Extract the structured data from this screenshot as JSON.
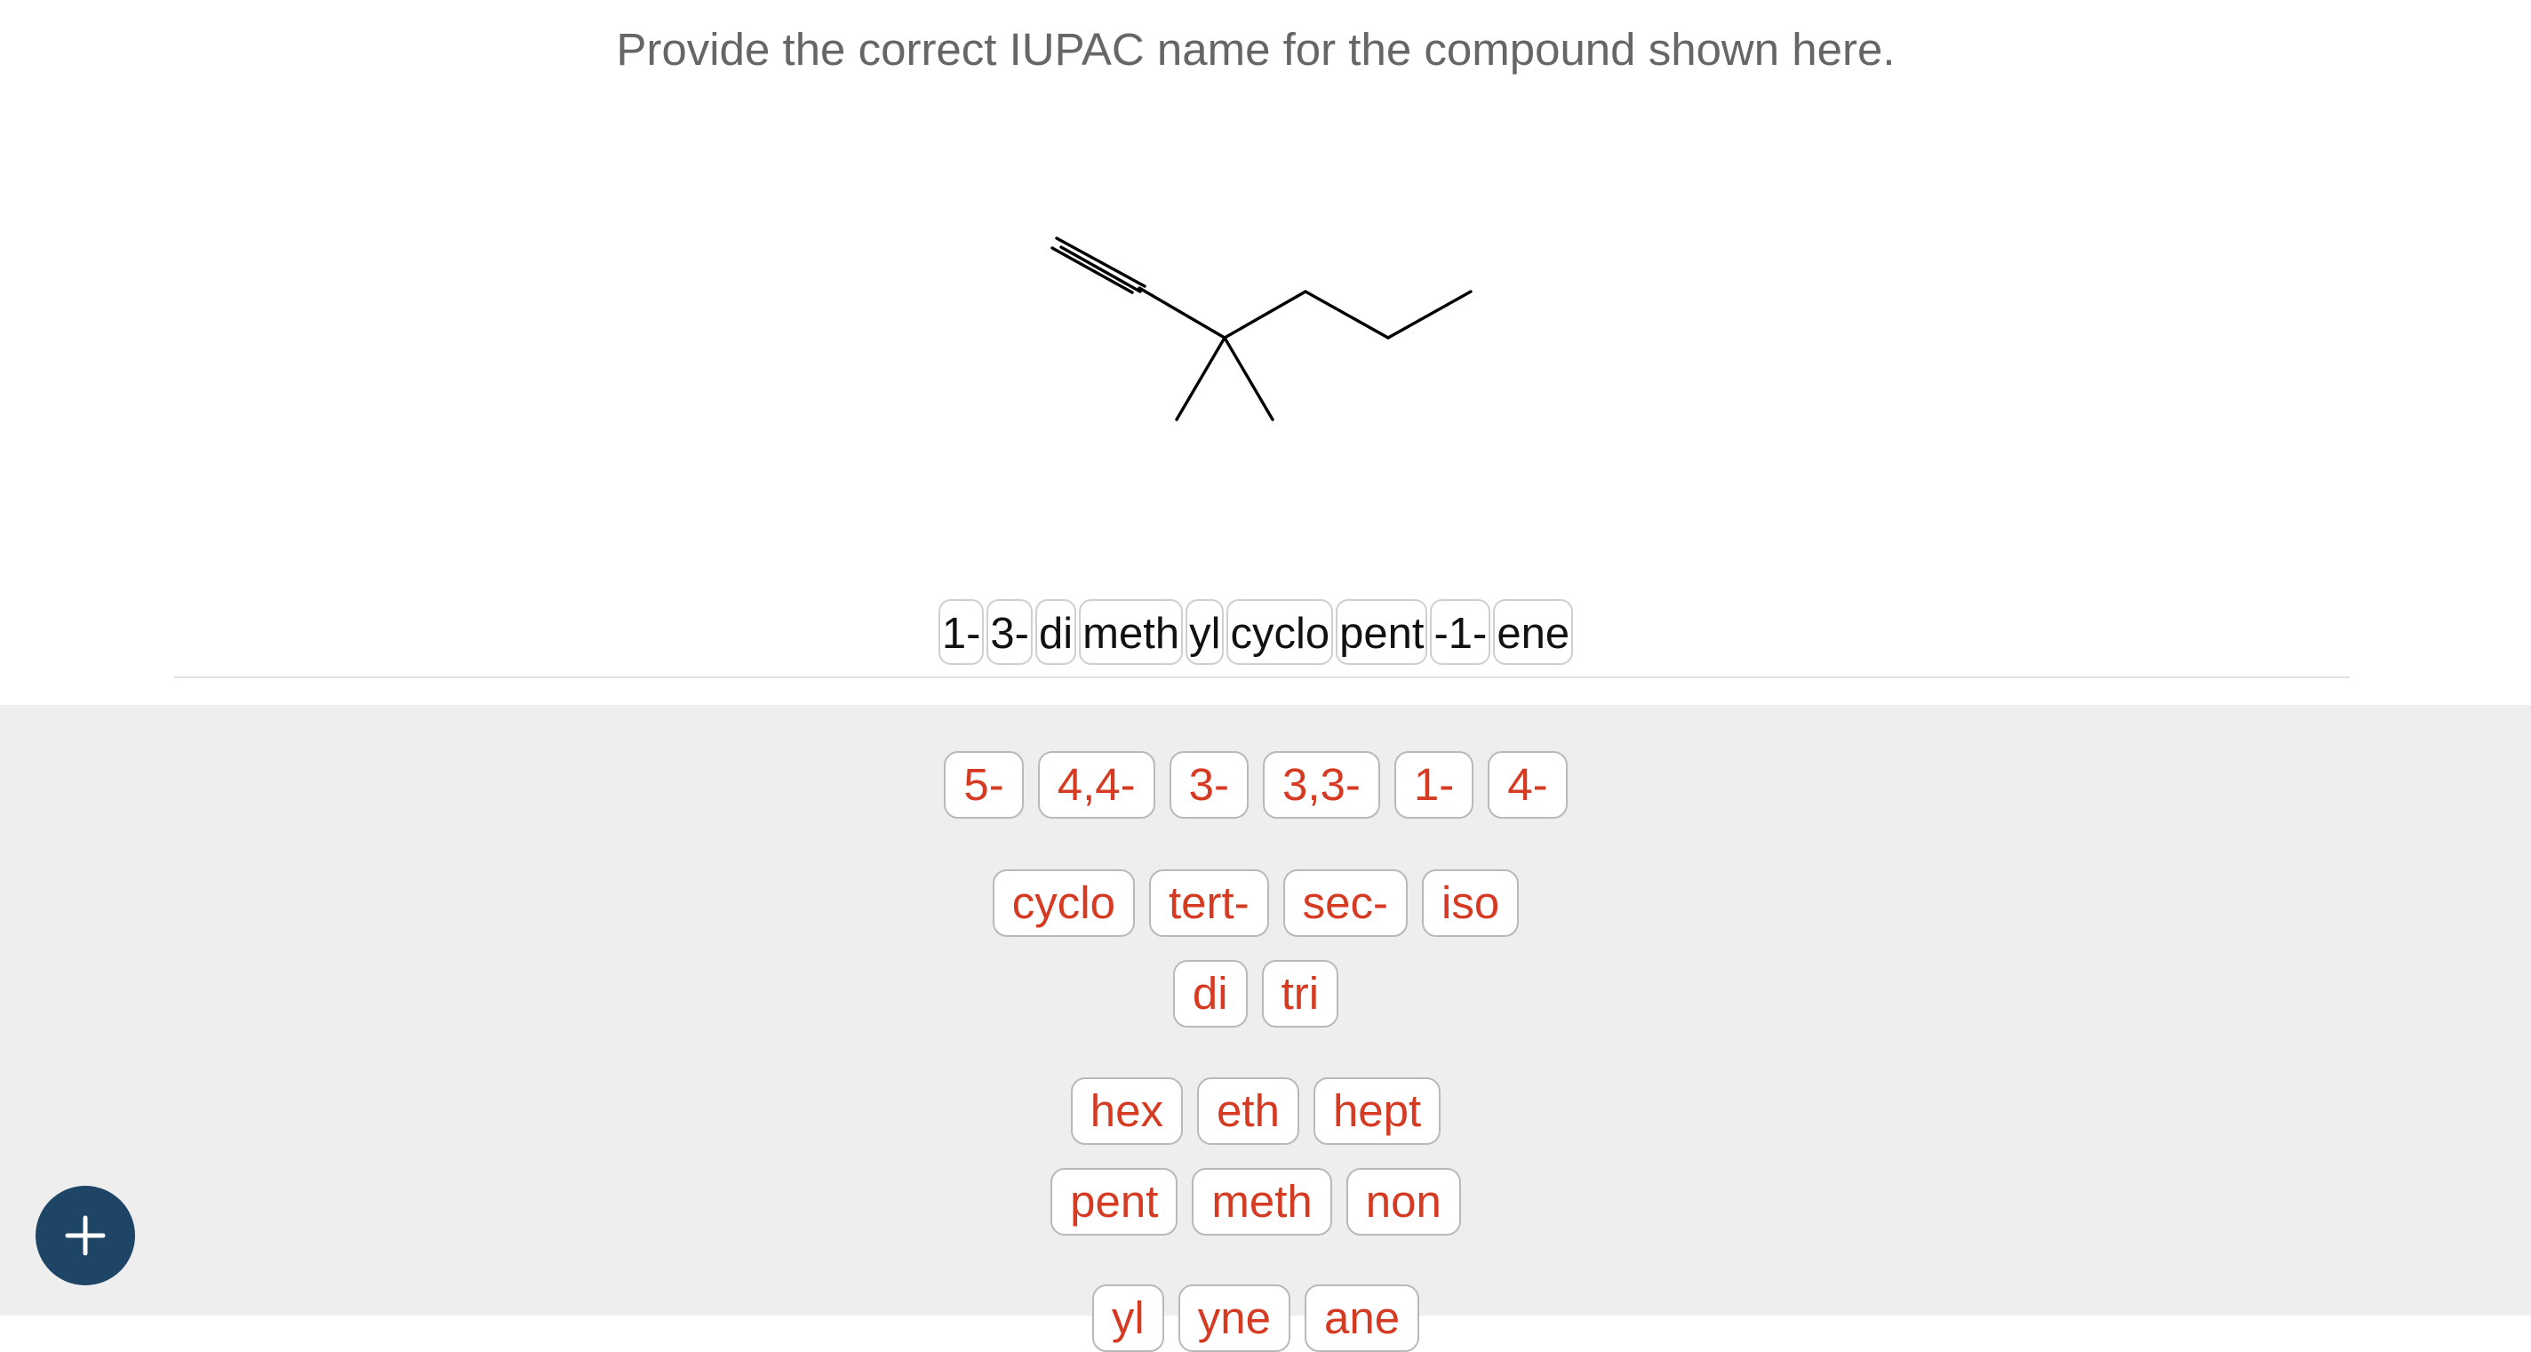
{
  "question": {
    "prompt": "Provide the correct IUPAC name for the compound shown here."
  },
  "answer_chips": [
    "1-",
    "3-",
    "di",
    "meth",
    "yl",
    "cyclo",
    "pent",
    "-1-",
    "ene"
  ],
  "bank": {
    "row1": [
      "5-",
      "4,4-",
      "3-",
      "3,3-",
      "1-",
      "4-"
    ],
    "row2": [
      "cyclo",
      "tert-",
      "sec-",
      "iso"
    ],
    "row3": [
      "di",
      "tri"
    ],
    "row4": [
      "hex",
      "eth",
      "hept"
    ],
    "row5": [
      "pent",
      "meth",
      "non"
    ],
    "row6": [
      "yl",
      "yne",
      "ane"
    ]
  },
  "colors": {
    "tile_text": "#d53a22",
    "bank_background": "#eeeeee",
    "add_button": "#1e4466"
  },
  "icons": {
    "add": "plus-icon"
  }
}
